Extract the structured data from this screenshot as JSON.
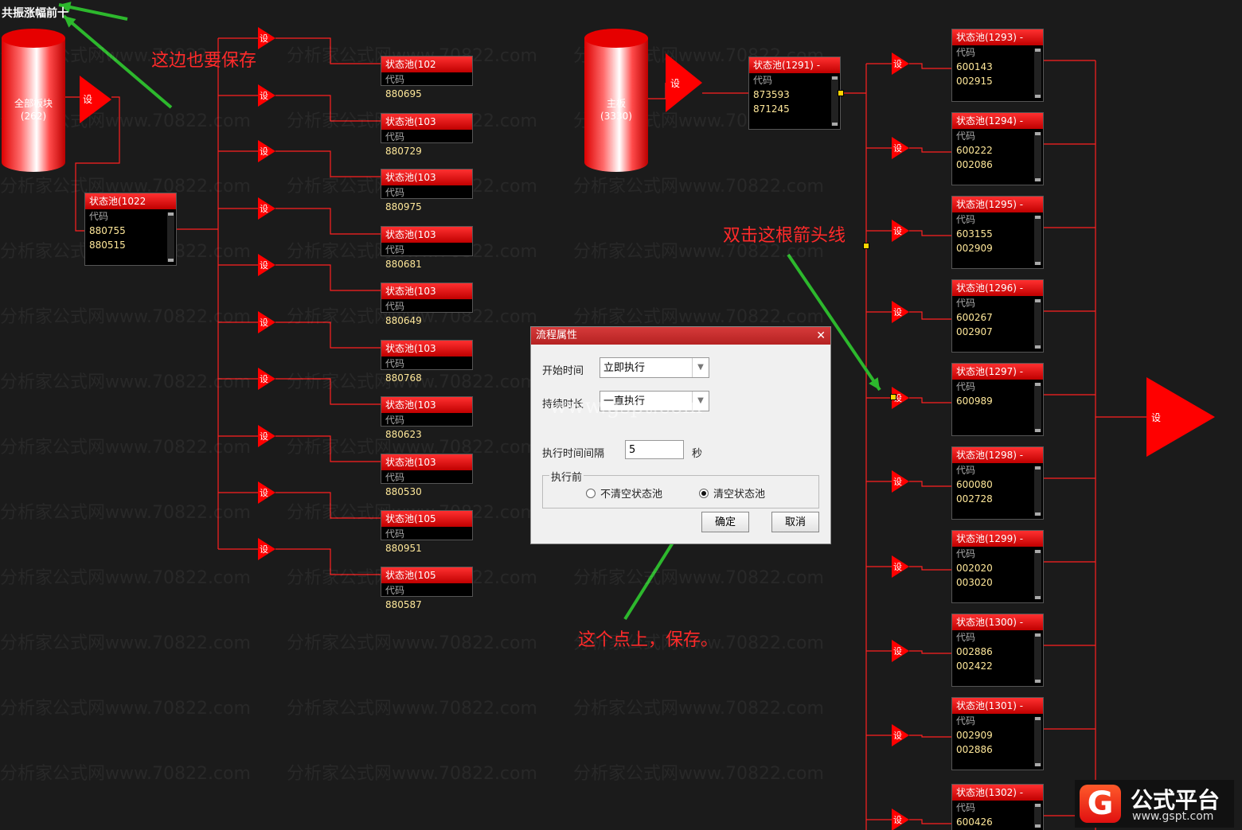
{
  "title": "共振涨幅前十",
  "watermark": "分析家公式网www.70822.com",
  "set_label": "设",
  "code_label": "代码",
  "cylinders": [
    {
      "name": "全部板块",
      "count": "(262)"
    },
    {
      "name": "主板",
      "count": "(3330)"
    }
  ],
  "left_source_pool": {
    "title": "状态池(1022",
    "codes": [
      "880755",
      "880515"
    ]
  },
  "left_pools": [
    {
      "title": "状态池(102",
      "codes": [
        "880695"
      ]
    },
    {
      "title": "状态池(103",
      "codes": [
        "880729"
      ]
    },
    {
      "title": "状态池(103",
      "codes": [
        "880975"
      ]
    },
    {
      "title": "状态池(103",
      "codes": [
        "880681"
      ]
    },
    {
      "title": "状态池(103",
      "codes": [
        "880649"
      ]
    },
    {
      "title": "状态池(103",
      "codes": [
        "880768"
      ]
    },
    {
      "title": "状态池(103",
      "codes": [
        "880623"
      ]
    },
    {
      "title": "状态池(103",
      "codes": [
        "880530"
      ]
    },
    {
      "title": "状态池(105",
      "codes": [
        "880951"
      ]
    },
    {
      "title": "状态池(105",
      "codes": [
        "880587"
      ]
    }
  ],
  "main_pool": {
    "title": "状态池(1291) -",
    "codes": [
      "873593",
      "871245"
    ]
  },
  "right_pools": [
    {
      "title": "状态池(1293) -",
      "codes": [
        "600143",
        "002915"
      ]
    },
    {
      "title": "状态池(1294) -",
      "codes": [
        "600222",
        "002086"
      ]
    },
    {
      "title": "状态池(1295) -",
      "codes": [
        "603155",
        "002909"
      ]
    },
    {
      "title": "状态池(1296) -",
      "codes": [
        "600267",
        "002907"
      ]
    },
    {
      "title": "状态池(1297) -",
      "codes": [
        "600989"
      ]
    },
    {
      "title": "状态池(1298) -",
      "codes": [
        "600080",
        "002728"
      ]
    },
    {
      "title": "状态池(1299) -",
      "codes": [
        "002020",
        "003020"
      ]
    },
    {
      "title": "状态池(1300) -",
      "codes": [
        "002886",
        "002422"
      ]
    },
    {
      "title": "状态池(1301) -",
      "codes": [
        "002909",
        "002886"
      ]
    },
    {
      "title": "状态池(1302) -",
      "codes": [
        "600426"
      ]
    }
  ],
  "annotations": {
    "save_here_too": "这边也要保存",
    "double_click": "双击这根箭头线",
    "click_save": "这个点上，保存。"
  },
  "dialog": {
    "title": "流程属性",
    "start_time_label": "开始时间",
    "start_time_value": "立即执行",
    "duration_label": "持续时长",
    "duration_value": "一直执行",
    "interval_label": "执行时间间隔",
    "interval_value": "5",
    "interval_unit": "秒",
    "group_label": "执行前",
    "option_no_clear": "不清空状态池",
    "option_clear": "清空状态池",
    "selected_option": "清空状态池",
    "ok": "确定",
    "cancel": "取消",
    "overlay_watermark": "www.gspt.com"
  },
  "logo": {
    "name": "公式平台",
    "url": "www.gspt.com"
  },
  "colors": {
    "accent": "#ff0000",
    "wire": "#ff2020",
    "arrow": "#2db82d",
    "background": "#1b1b1b"
  }
}
